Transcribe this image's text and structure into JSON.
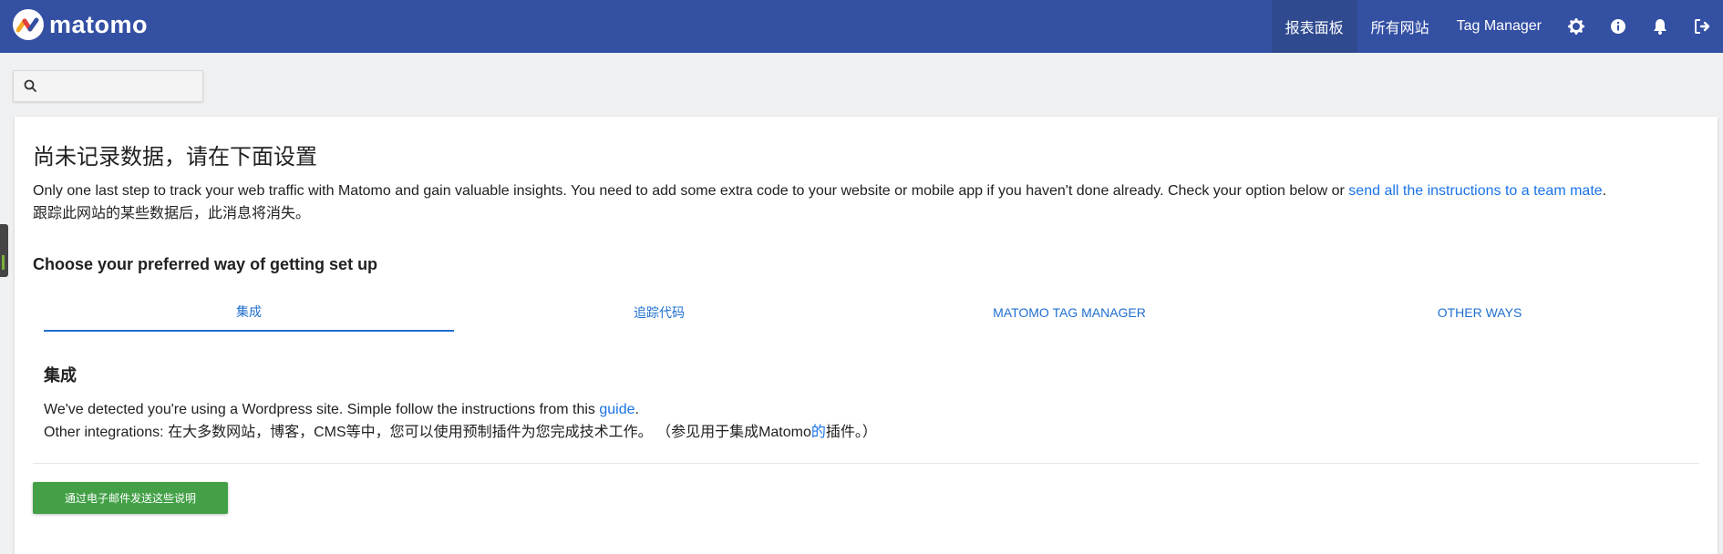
{
  "brand": {
    "name": "matomo"
  },
  "topnav": {
    "items": [
      "报表面板",
      "所有网站",
      "Tag Manager"
    ],
    "icons": [
      "gear-icon",
      "info-icon",
      "bell-icon",
      "logout-icon"
    ]
  },
  "search": {
    "value": "",
    "placeholder": ""
  },
  "main": {
    "title": "尚未记录数据，请在下面设置",
    "intro_text": "Only one last step to track your web traffic with Matomo and gain valuable insights. You need to add some extra code to your website or mobile app if you haven't done already. Check your option below or ",
    "intro_link": "send all the instructions to a team mate",
    "intro_end": ".",
    "notice": "跟踪此网站的某些数据后，此消息将消失。",
    "setup_title": "Choose your preferred way of getting set up",
    "tabs": [
      {
        "label": "集成"
      },
      {
        "label": "追踪代码"
      },
      {
        "label": "MATOMO TAG MANAGER"
      },
      {
        "label": "OTHER WAYS"
      }
    ],
    "section": {
      "title": "集成",
      "detect_text": "We've detected you're using a Wordpress site. Simple follow the instructions from this ",
      "detect_link": "guide",
      "detect_end": ".",
      "other_text": "Other integrations: 在大多数网站，博客，CMS等中，您可以使用预制插件为您完成技术工作。 （参见用于集成Matomo",
      "other_link": "的",
      "other_end": "插件。）"
    },
    "email_button": "通过电子邮件发送这些说明"
  },
  "colors": {
    "topbar": "#3450a3",
    "link": "#1a73e8",
    "button": "#43a047"
  }
}
